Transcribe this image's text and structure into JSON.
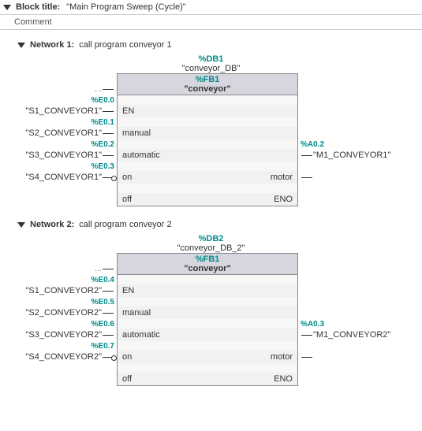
{
  "header": {
    "block_title_label": "Block title:",
    "block_title_value": "\"Main Program Sweep (Cycle)\"",
    "comment_label": "Comment"
  },
  "networks": [
    {
      "label": "Network 1:",
      "title": "call program conveyor 1",
      "db_symbol": "%DB1",
      "db_name": "\"conveyor_DB\"",
      "fb_symbol": "%FB1",
      "fb_name": "\"conveyor\"",
      "inputs": [
        {
          "sym": "",
          "tag": "...",
          "pin": "EN",
          "neg": false,
          "dots": true
        },
        {
          "sym": "%E0.0",
          "tag": "\"S1_CONVEYOR1\"",
          "pin": "manual",
          "neg": false
        },
        {
          "sym": "%E0.1",
          "tag": "\"S2_CONVEYOR1\"",
          "pin": "automatic",
          "neg": false
        },
        {
          "sym": "%E0.2",
          "tag": "\"S3_CONVEYOR1\"",
          "pin": "on",
          "neg": false
        },
        {
          "sym": "%E0.3",
          "tag": "\"S4_CONVEYOR1\"",
          "pin": "off",
          "neg": true
        }
      ],
      "outputs": [
        {
          "sym": "%A0.2",
          "tag": "\"M1_CONVEYOR1\"",
          "pin": "motor"
        },
        {
          "sym": "",
          "tag": "",
          "pin": "ENO"
        }
      ]
    },
    {
      "label": "Network 2:",
      "title": "call program conveyor 2",
      "db_symbol": "%DB2",
      "db_name": "\"conveyor_DB_2\"",
      "fb_symbol": "%FB1",
      "fb_name": "\"conveyor\"",
      "inputs": [
        {
          "sym": "",
          "tag": "...",
          "pin": "EN",
          "neg": false,
          "dots": true
        },
        {
          "sym": "%E0.4",
          "tag": "\"S1_CONVEYOR2\"",
          "pin": "manual",
          "neg": false
        },
        {
          "sym": "%E0.5",
          "tag": "\"S2_CONVEYOR2\"",
          "pin": "automatic",
          "neg": false
        },
        {
          "sym": "%E0.6",
          "tag": "\"S3_CONVEYOR2\"",
          "pin": "on",
          "neg": false
        },
        {
          "sym": "%E0.7",
          "tag": "\"S4_CONVEYOR2\"",
          "pin": "off",
          "neg": true
        }
      ],
      "outputs": [
        {
          "sym": "%A0.3",
          "tag": "\"M1_CONVEYOR2\"",
          "pin": "motor"
        },
        {
          "sym": "",
          "tag": "",
          "pin": "ENO"
        }
      ]
    }
  ]
}
